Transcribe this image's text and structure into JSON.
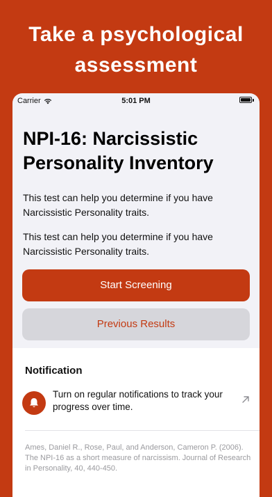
{
  "promo": {
    "line1": "Take a psychological",
    "line2": "assessment"
  },
  "statusbar": {
    "carrier": "Carrier",
    "time": "5:01 PM"
  },
  "screen": {
    "title_line1": "NPI-16: Narcissistic",
    "title_line2": "Personality Inventory",
    "description_1": "This test can help you determine if you have Narcissistic Personality traits.",
    "description_2": "This test can help you determine if you have Narcissistic Personality traits.",
    "start_button": "Start Screening",
    "previous_button": "Previous Results"
  },
  "notification": {
    "section_title": "Notification",
    "text": "Turn on regular notifications to track your progress over time.",
    "icon": "bell-icon"
  },
  "citation": "Ames, Daniel R., Rose, Paul, and Anderson, Cameron P. (2006). The NPI-16 as a short measure of narcissism. Journal of Research in Personality, 40, 440-450.",
  "colors": {
    "accent": "#C33A12",
    "background": "#F2F2F7",
    "secondary_button": "#D6D6DB"
  }
}
